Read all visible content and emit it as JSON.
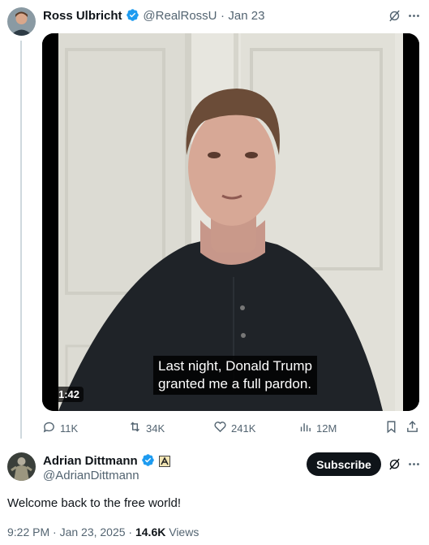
{
  "tweet": {
    "author_name": "Ross Ulbricht",
    "handle": "@RealRossU",
    "separator": "·",
    "date": "Jan 23",
    "video": {
      "caption_line1": "Last night, Donald Trump",
      "caption_line2": "granted me a full pardon.",
      "duration": "1:42"
    },
    "actions": {
      "replies": "11K",
      "reposts": "34K",
      "likes": "241K",
      "views": "12M"
    }
  },
  "reply": {
    "author_name": "Adrian Dittmann",
    "handle": "@AdrianDittmann",
    "subscribe_label": "Subscribe",
    "text": "Welcome back to the free world!",
    "time": "9:22 PM · Jan 23, 2025 ·",
    "views_count": "14.6K",
    "views_label": "Views"
  },
  "colors": {
    "verified": "#1d9bf0",
    "muted": "#536471",
    "text": "#0f1419",
    "line": "#cfd9de"
  },
  "icons": [
    "verified-icon",
    "grok-icon",
    "more-icon",
    "reply-icon",
    "repost-icon",
    "like-icon",
    "views-icon",
    "bookmark-icon",
    "share-icon",
    "affiliate-badge-icon"
  ]
}
